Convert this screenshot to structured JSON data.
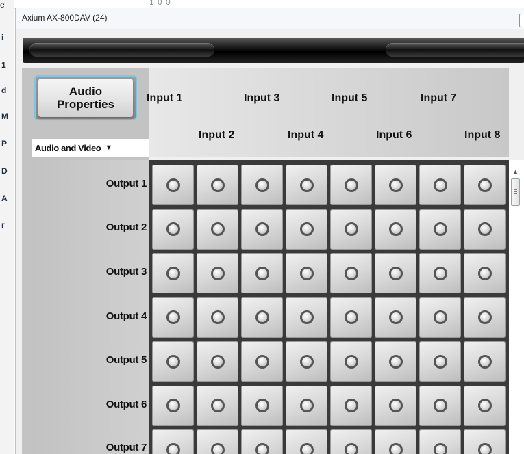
{
  "background": {
    "top_fragment": "e",
    "number_fragment": "1 0 0",
    "fragments": [
      "i",
      "1",
      "d",
      "M",
      "P",
      "D",
      "A",
      "r"
    ]
  },
  "window": {
    "title": "Axium AX-800DAV (24)"
  },
  "left_panel": {
    "audio_button_line1": "Audio",
    "audio_button_line2": "Properties",
    "mode_dropdown_value": "Audio and Video"
  },
  "inputs": [
    "Input 1",
    "Input 2",
    "Input 3",
    "Input 4",
    "Input 5",
    "Input 6",
    "Input 7",
    "Input 8"
  ],
  "outputs": [
    "Output 1",
    "Output 2",
    "Output 3",
    "Output 4",
    "Output 5",
    "Output 6",
    "Output 7"
  ],
  "colors": {
    "button_focus_border": "#7ec6e4",
    "matrix_background": "#3a3a3a",
    "header_bar": "#000000"
  },
  "icons": {
    "dropdown": "chevron-down-icon",
    "scroll_up": "triangle-up-icon",
    "crosspoint": "circle-knob-icon"
  }
}
